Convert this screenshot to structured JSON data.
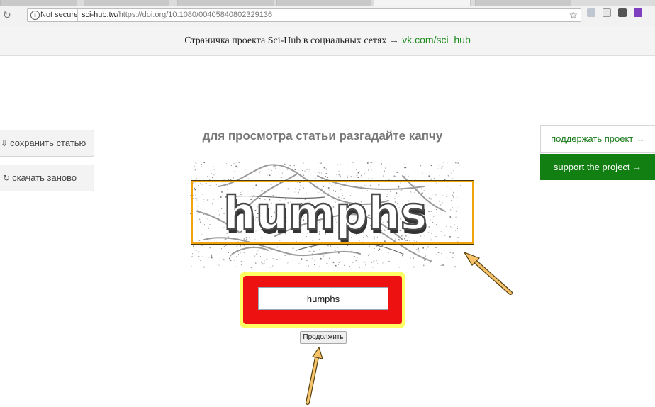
{
  "browser": {
    "reload_icon": "reload-icon",
    "security_label": "Not secure",
    "url_host": "sci-hub.tw/",
    "url_path": "https://doi.org/10.1080/00405840802329136",
    "bookmark_icon": "star-icon"
  },
  "banner": {
    "text": "Страничка проекта Sci-Hub в социальных сетях →",
    "link": "vk.com/sci_hub"
  },
  "left_buttons": {
    "save_label": "сохранить статью",
    "save_icon": "download-icon",
    "reload_label": "скачать заново",
    "reload_icon": "refresh-icon"
  },
  "right_buttons": {
    "support_ru": "поддержать проект →",
    "support_en": "support the project →"
  },
  "captcha": {
    "heading": "для просмотра статьи разгадайте капчу",
    "image_word": "humphs",
    "answer_value": "humphs",
    "submit_label": "Продолжить"
  },
  "colors": {
    "green_link": "#1a8a1a",
    "support_button": "#117f11",
    "highlight_orange": "#f0a30a",
    "highlight_red": "#ee1111",
    "highlight_yellow": "#ffff66"
  }
}
